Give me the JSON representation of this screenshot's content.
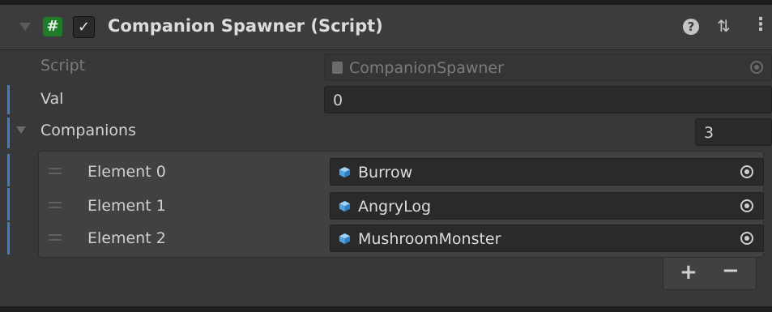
{
  "component": {
    "title": "Companion Spawner (Script)",
    "enabled": true,
    "help_glyph": "?",
    "presets_glyph": "⇅",
    "menu_glyph": "⋮",
    "accent_color": "#3f7fc9"
  },
  "fields": {
    "script_label": "Script",
    "script_value": "CompanionSpawner",
    "val_label": "Val",
    "val_value": "0",
    "companions_label": "Companions",
    "companions_count": "3"
  },
  "elements": [
    {
      "label": "Element 0",
      "value": "Burrow",
      "icon": "prefab-cube-icon"
    },
    {
      "label": "Element 1",
      "value": "AngryLog",
      "icon": "prefab-cube-icon"
    },
    {
      "label": "Element 2",
      "value": "MushroomMonster",
      "icon": "prefab-cube-icon"
    }
  ],
  "list_footer": {
    "add_label": "+",
    "remove_label": "−"
  }
}
